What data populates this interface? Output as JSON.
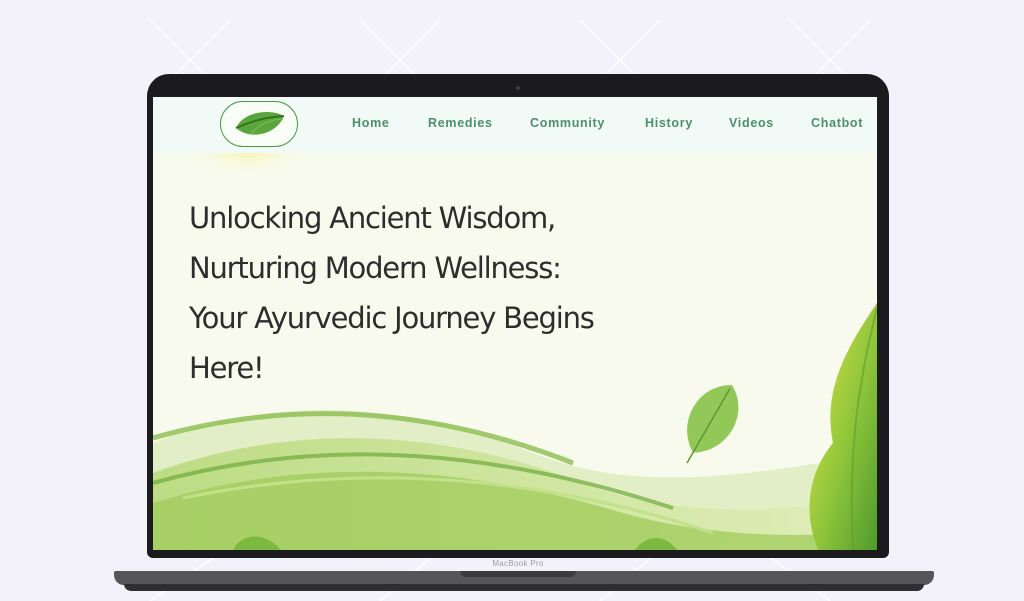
{
  "nav": {
    "logo_icon": "leaf-icon",
    "items": [
      {
        "label": "Home"
      },
      {
        "label": "Remedies"
      },
      {
        "label": "Community"
      },
      {
        "label": "History"
      },
      {
        "label": "Videos"
      },
      {
        "label": "Chatbot"
      }
    ]
  },
  "hero": {
    "headline_lines": [
      "Unlocking Ancient Wisdom,",
      "Nurturing Modern Wellness:",
      "Your Ayurvedic Journey Begins",
      "Here!"
    ]
  },
  "device": {
    "label": "MacBook Pro"
  },
  "colors": {
    "page_bg": "#f3f2fb",
    "nav_bg": "#f1faf7",
    "nav_text": "#4d8f6a",
    "leaf_green": "#5aa63c",
    "headline_text": "#2d2d2d"
  }
}
